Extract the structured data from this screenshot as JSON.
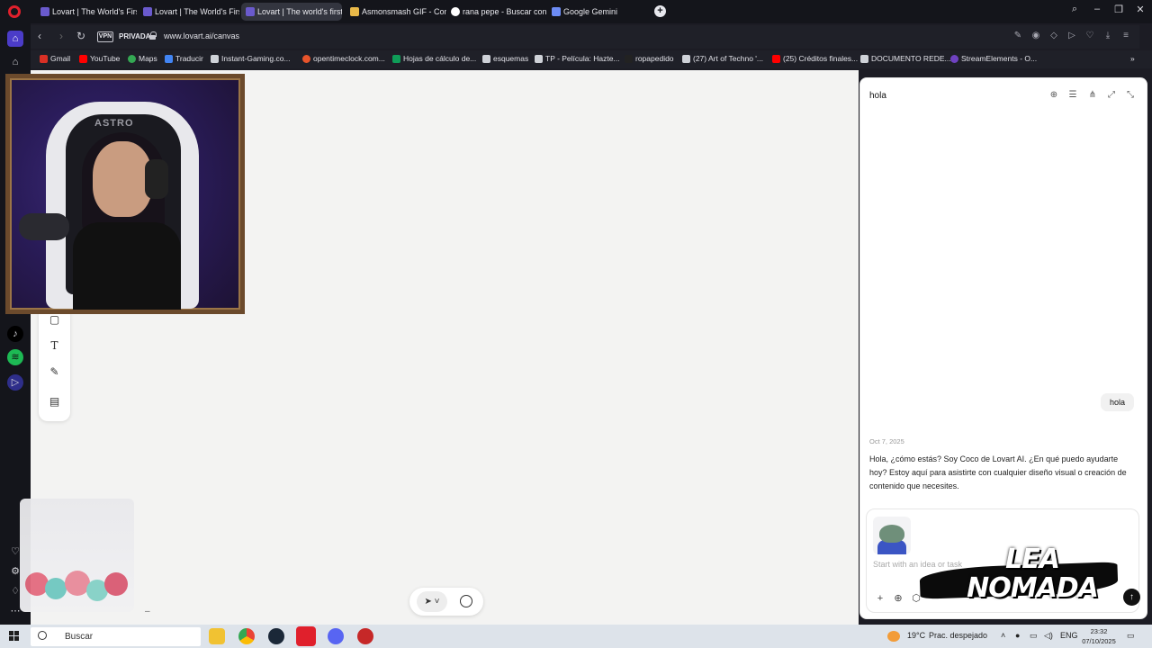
{
  "browser": {
    "tabs": [
      {
        "label": "Lovart | The World's First",
        "favicon_color": "#6a5acd"
      },
      {
        "label": "Lovart | The World's First",
        "favicon_color": "#6a5acd"
      },
      {
        "label": "Lovart | The world's first d",
        "favicon_color": "#6a5acd",
        "active": true
      },
      {
        "label": "Asmonsmash GIF - Conse",
        "favicon_color": "#e9b949"
      },
      {
        "label": "rana pepe - Buscar con G",
        "favicon_color": "#ffffff"
      },
      {
        "label": "Google Gemini",
        "favicon_color": "#6d8cf5"
      }
    ],
    "vpn_label": "VPN",
    "private_label": "PRIVADA",
    "url": "www.lovart.ai/canvas",
    "bookmarks": [
      {
        "label": "Gmail",
        "color": "#d93025"
      },
      {
        "label": "YouTube",
        "color": "#ff0000"
      },
      {
        "label": "Maps",
        "color": "#34a853"
      },
      {
        "label": "Traducir",
        "color": "#4285f4"
      },
      {
        "label": "Instant-Gaming.co...",
        "color": "#cfd2d8"
      },
      {
        "label": "opentimeclock.com...",
        "color": "#e8542b"
      },
      {
        "label": "Hojas de cálculo de...",
        "color": "#0f9d58"
      },
      {
        "label": "esquemas",
        "color": "#cfd2d8"
      },
      {
        "label": "TP - Película: Hazte...",
        "color": "#cfd2d8"
      },
      {
        "label": "ropapedido",
        "color": "#222222"
      },
      {
        "label": "(27) Art of Techno '...",
        "color": "#cfd2d8"
      },
      {
        "label": "(25) Créditos finales...",
        "color": "#ff0000"
      },
      {
        "label": "DOCUMENTO REDE...",
        "color": "#cfd2d8"
      },
      {
        "label": "StreamElements - O...",
        "color": "#6f42c1"
      }
    ]
  },
  "canvas": {
    "zoom_dash": "–"
  },
  "chat": {
    "title": "hola",
    "user_message": "hola",
    "date": "Oct 7, 2025",
    "reply": "Hola, ¿cómo estás? Soy Coco de Lovart AI. ¿En qué puedo ayudarte hoy? Estoy aquí para asistirte con cualquier diseño visual o creación de contenido que necesites.",
    "input_placeholder": "Start with an idea or task"
  },
  "webcam": {
    "chair_text": "ASTRO"
  },
  "watermark": {
    "line1": "LEA",
    "line2": "NOMADA"
  },
  "taskbar": {
    "search_label": "Buscar",
    "weather": "19°C",
    "weather_desc": "Prac. despejado",
    "language": "ENG",
    "time": "23:32",
    "date": "07/10/2025"
  }
}
